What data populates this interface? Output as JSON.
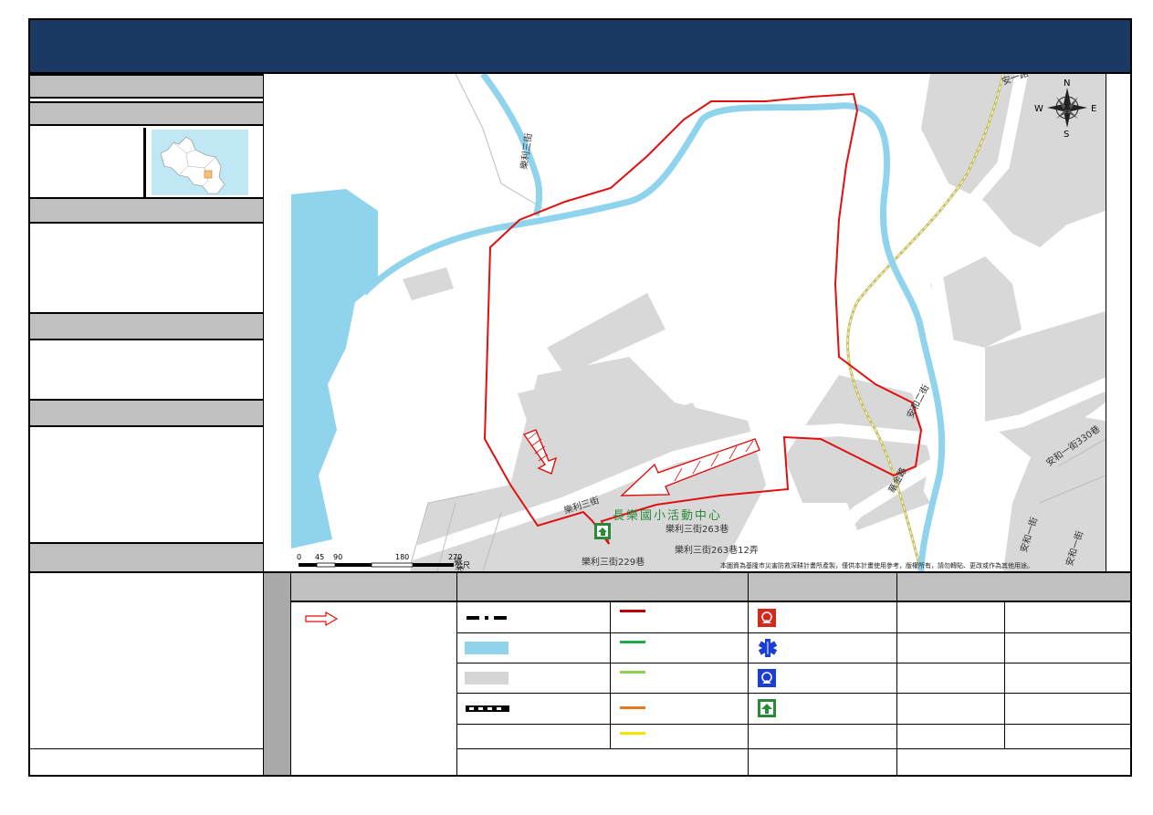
{
  "map": {
    "streets": [
      {
        "id": "s1",
        "label": "樂利三街"
      },
      {
        "id": "s2",
        "label": "樂利三街263巷"
      },
      {
        "id": "s3",
        "label": "樂利三街263巷12弄"
      },
      {
        "id": "s4",
        "label": "樂利三街229巷"
      },
      {
        "id": "s5",
        "label": "樂利三街318巷"
      },
      {
        "id": "s6",
        "label": "樂利三街"
      },
      {
        "id": "s7",
        "label": "安和二街"
      },
      {
        "id": "s8",
        "label": "安和一街330巷"
      },
      {
        "id": "s9",
        "label": "安和一街"
      },
      {
        "id": "s10",
        "label": "安和一街"
      },
      {
        "id": "s11",
        "label": "華金路"
      },
      {
        "id": "s12",
        "label": "安一路"
      }
    ],
    "facility_label": "長樂國小活動中心",
    "compass": {
      "n": "N",
      "s": "S",
      "e": "E",
      "w": "W"
    },
    "scale": {
      "ticks": [
        "0",
        "45",
        "90",
        "180",
        "270"
      ],
      "unit": "公尺"
    },
    "disclaimer": "本圖資為基隆市災害防救深耕計畫所產製，僅供本計畫使用參考，版權所有，請勿轉貼、更改或作為其他用途。",
    "colors": {
      "water": "#8fd3ec",
      "building": "#d6d6d6",
      "road": "#ffffff",
      "boundary": "#e01010",
      "rail": "#c9c060"
    }
  }
}
